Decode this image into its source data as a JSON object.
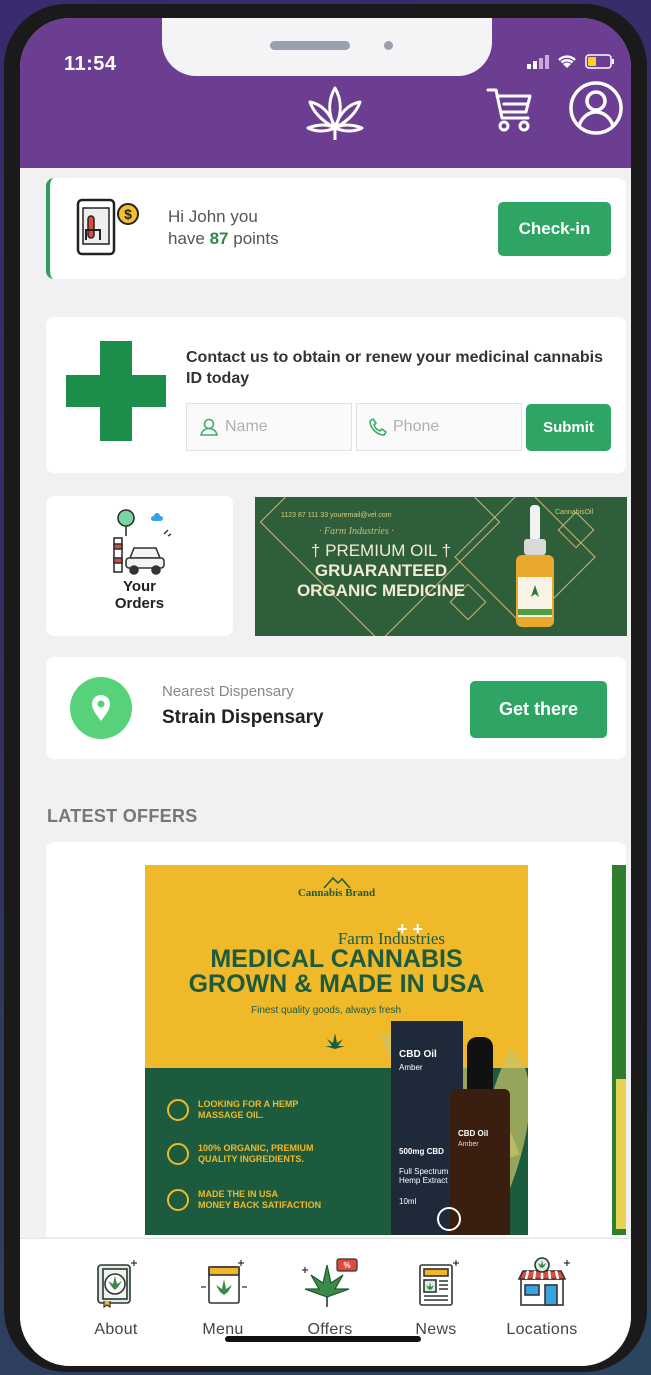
{
  "status_bar": {
    "time": "11:54"
  },
  "header": {
    "logo_icon": "cannabis-leaf-icon",
    "cart_icon": "shopping-cart-icon",
    "profile_icon": "user-circle-icon",
    "color": "#6c3e92"
  },
  "points_card": {
    "greeting_line1": "Hi John you",
    "greeting_prefix": "have ",
    "points": "87",
    "greeting_suffix": " points",
    "checkin_label": "Check-in",
    "icon": "phone-tap-coin-icon"
  },
  "contact_card": {
    "title": "Contact us to obtain or renew your medicinal cannabis ID today",
    "name_placeholder": "Name",
    "phone_placeholder": "Phone",
    "submit_label": "Submit",
    "icon": "medical-cross-icon"
  },
  "orders_card": {
    "label_line1": "Your",
    "label_line2": "Orders",
    "icon": "delivery-car-icon"
  },
  "promo_banner": {
    "contact_line": "1123 87 111 33       youremail@vel.com",
    "brand": "· Farm Industries ·",
    "line1": "† PREMIUM OIL †",
    "line2": "GRUARANTEED",
    "line3": "ORGANIC MEDICINE",
    "corner_logo": "CannabisOil"
  },
  "dispensary_card": {
    "subtitle": "Nearest Dispensary",
    "name": "Strain Dispensary",
    "button_label": "Get there",
    "icon": "location-pin-icon"
  },
  "offers": {
    "section_title": "LATEST OFFERS",
    "offer1": {
      "brand": "Cannabis Brand",
      "farm": "Farm Industries",
      "headline_line1": "MEDICAL CANNABIS",
      "headline_line2": "GROWN & MADE IN USA",
      "tagline": "Finest quality goods, always fresh",
      "bullets": [
        {
          "line1": "LOOKING FOR A HEMP",
          "line2": "MASSAGE OIL."
        },
        {
          "line1": "100% ORGANIC, PREMIUM",
          "line2": "QUALITY INGREDIENTS."
        },
        {
          "line1": "MADE THE IN USA",
          "line2": "MONEY BACK SATIFACTION"
        }
      ],
      "box_title": "CBD Oil",
      "box_sub": "Amber",
      "box_dose": "500mg CBD",
      "box_desc": "Full Spectrum Hemp Extract",
      "box_vol": "10ml"
    }
  },
  "tab_bar": {
    "tabs": [
      {
        "label": "About",
        "icon": "book-leaf-icon"
      },
      {
        "label": "Menu",
        "icon": "menu-leaf-icon"
      },
      {
        "label": "Offers",
        "icon": "leaf-discount-icon"
      },
      {
        "label": "News",
        "icon": "newspaper-icon"
      },
      {
        "label": "Locations",
        "icon": "storefront-icon"
      }
    ]
  }
}
